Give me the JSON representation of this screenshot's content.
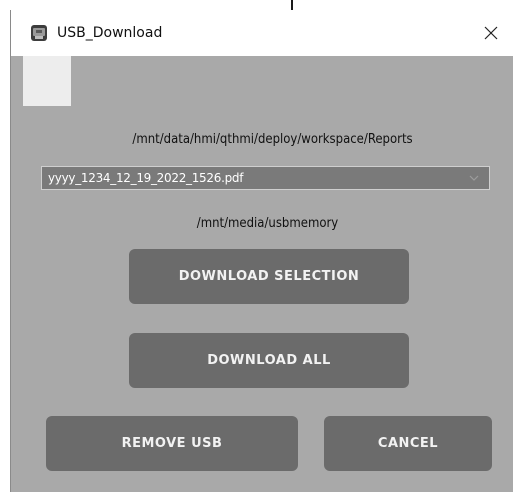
{
  "window": {
    "title": "USB_Download",
    "close_glyph": "✕"
  },
  "source_path": "/mnt/data/hmi/qthmi/deploy/workspace/Reports",
  "file_select": {
    "selected": "yyyy_1234_12_19_2022_1526.pdf"
  },
  "destination_path": "/mnt/media/usbmemory",
  "buttons": {
    "download_selection": "DOWNLOAD SELECTION",
    "download_all": "DOWNLOAD ALL",
    "remove_usb": "REMOVE USB",
    "cancel": "CANCEL"
  },
  "icons": {
    "app": "usb-app-icon",
    "close": "close-icon",
    "dropdown": "chevron-down-icon"
  },
  "colors": {
    "dialog_bg": "#a9a9a9",
    "button_bg": "#6b6b6b",
    "button_text": "#f2f2f2",
    "select_bg": "#7a7a7a"
  }
}
